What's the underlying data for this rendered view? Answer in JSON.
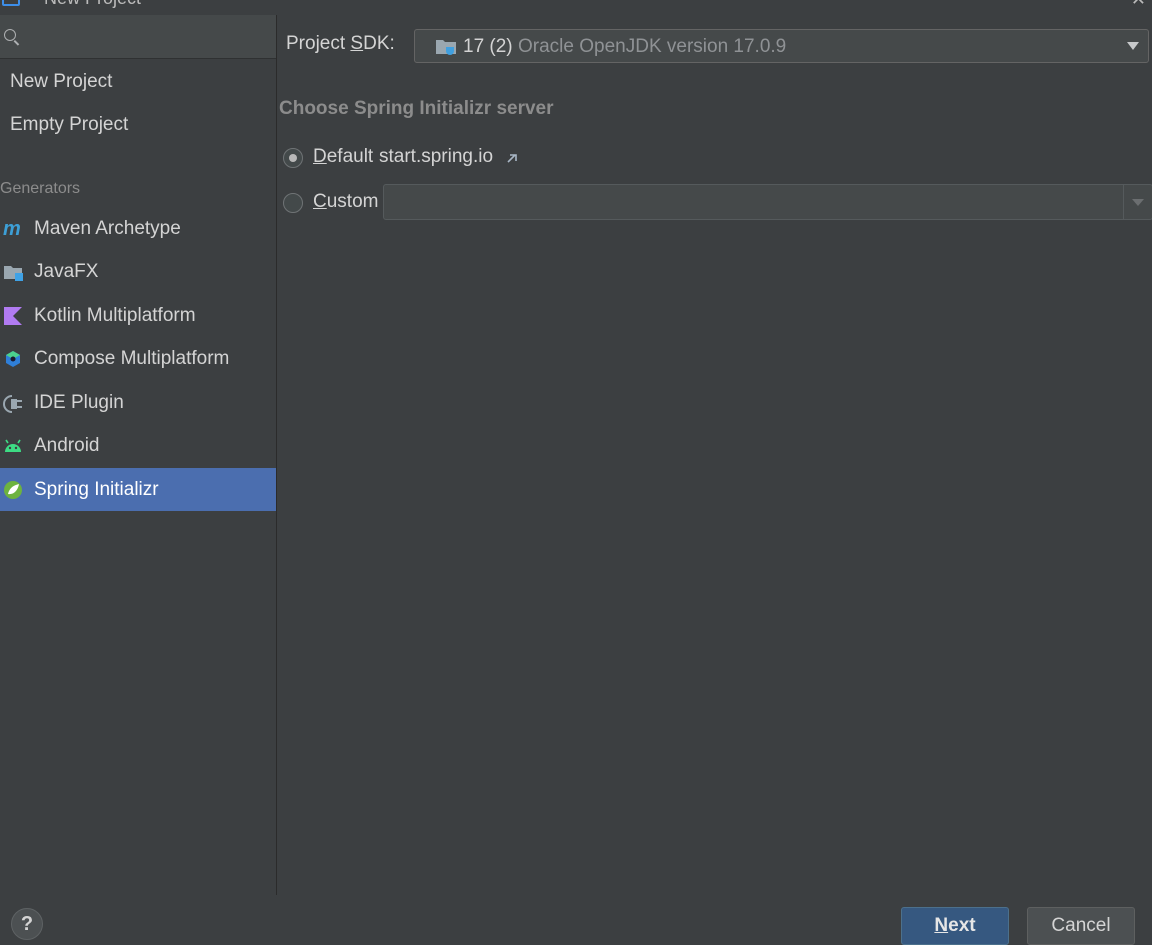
{
  "window": {
    "title": "New Project"
  },
  "sidebar": {
    "search": {
      "value": "",
      "placeholder": ""
    },
    "top_items": [
      {
        "label": "New Project"
      },
      {
        "label": "Empty Project"
      }
    ],
    "generators_header": "Generators",
    "generators": [
      {
        "label": "Maven Archetype",
        "icon": "maven-icon"
      },
      {
        "label": "JavaFX",
        "icon": "javafx-icon"
      },
      {
        "label": "Kotlin Multiplatform",
        "icon": "kotlin-icon"
      },
      {
        "label": "Compose Multiplatform",
        "icon": "compose-icon"
      },
      {
        "label": "IDE Plugin",
        "icon": "plugin-icon"
      },
      {
        "label": "Android",
        "icon": "android-icon"
      },
      {
        "label": "Spring Initializr",
        "icon": "spring-icon",
        "selected": true
      }
    ]
  },
  "main": {
    "sdk": {
      "label_pre": "Project ",
      "label_mnemonic": "S",
      "label_post": "DK:",
      "version": "17 (2)",
      "name": "Oracle OpenJDK version 17.0.9"
    },
    "section_title": "Choose Spring Initializr server",
    "server": {
      "default": {
        "mnemonic": "D",
        "label_rest": "efault",
        "url": "start.spring.io",
        "selected": true
      },
      "custom": {
        "mnemonic": "C",
        "label_rest": "ustom",
        "value": "",
        "selected": false
      }
    }
  },
  "footer": {
    "help": "?",
    "next": {
      "mnemonic": "N",
      "label_rest": "ext"
    },
    "cancel": "Cancel"
  },
  "colors": {
    "background": "#3c3f41",
    "selection": "#4b6eaf",
    "primary_button": "#365880"
  }
}
